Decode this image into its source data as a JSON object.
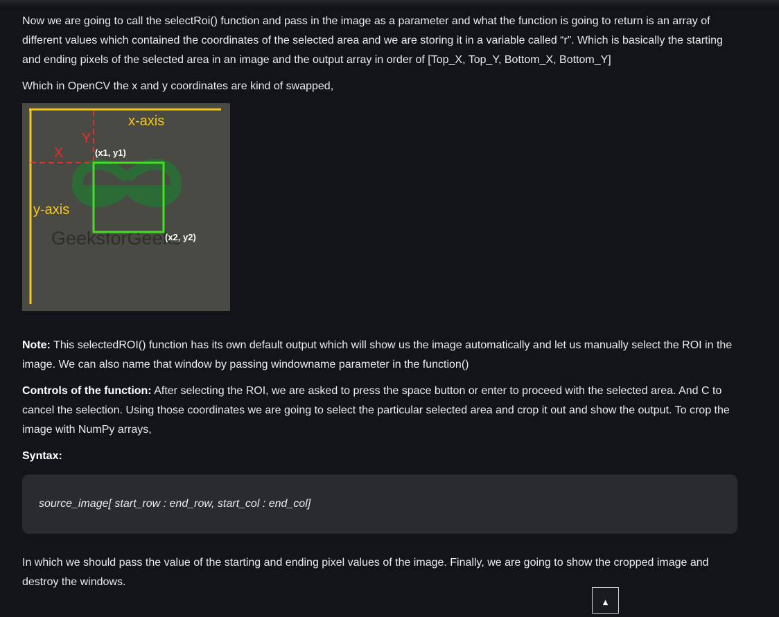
{
  "paragraphs": {
    "intro": "Now we are going to call the selectRoi() function and pass in the image as a parameter and what the function is going to return is an array of different values which contained the coordinates of the selected area and we are storing it in a variable called “r”. Which is basically the starting and ending pixels of the selected area in an image and the output array in order of  [Top_X, Top_Y, Bottom_X, Bottom_Y]",
    "swapped": "Which in OpenCV  the x and y coordinates are kind of swapped,",
    "note_label": "Note:",
    "note_text": " This selectedROI() function has its own default output which will show us the image automatically and let us manually select the ROI in the image. We can also name that window by passing windowname parameter in the function()",
    "controls_label": "Controls of the function:",
    "controls_text": " After selecting the ROI, we are asked to press the space button or enter to proceed with the selected area. And C to cancel the selection. Using those coordinates we are going to select the particular selected area and crop it out and show the output. To crop the image with NumPy arrays,",
    "syntax_label": "Syntax:",
    "closing": "In which we should pass the value of the starting and ending pixel values of the image. Finally, we are going to show the cropped image and destroy the windows."
  },
  "figure": {
    "x_axis": "x-axis",
    "y_axis": "y-axis",
    "x_mark": "X",
    "y_mark": "Y",
    "p1": "(x1, y1)",
    "p2": "(x2, y2)",
    "watermark": "GeeksforGeeks",
    "colors": {
      "background": "#4a4a44",
      "axis": "#f4c81e",
      "offset": "#ec2b2b",
      "roi": "#45e022",
      "logo": "#2c6b35"
    }
  },
  "code": {
    "text": "source_image[ start_row : end_row, start_col : end_col]"
  },
  "back_to_top": {
    "icon": "caret-up-icon",
    "glyph": "▲"
  }
}
